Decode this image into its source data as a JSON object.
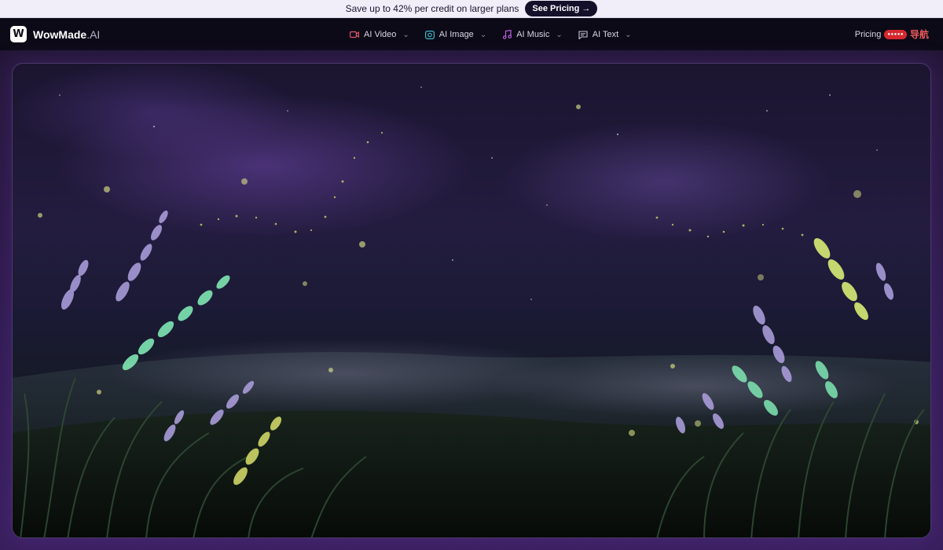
{
  "promo": {
    "text": "Save up to 42% per credit on larger plans",
    "cta_label": "See Pricing →"
  },
  "nav": {
    "brand_mark": "W",
    "brand_name": "WowMade",
    "brand_suffix": ".AI",
    "menu": [
      {
        "label": "AI Video",
        "icon": "video-icon",
        "color": "#e0566a"
      },
      {
        "label": "AI Image",
        "icon": "camera-icon",
        "color": "#3fb7c9"
      },
      {
        "label": "AI Music",
        "icon": "music-note-icon",
        "color": "#b35fe0"
      },
      {
        "label": "AI Text",
        "icon": "message-icon",
        "color": "#c9c4d8"
      }
    ],
    "pricing_label": "Pricing",
    "extension_badge": "导航"
  },
  "colors": {
    "background": "#0b0716",
    "accent_purple": "#3a1f5e",
    "cta_bg": "#15102a"
  }
}
